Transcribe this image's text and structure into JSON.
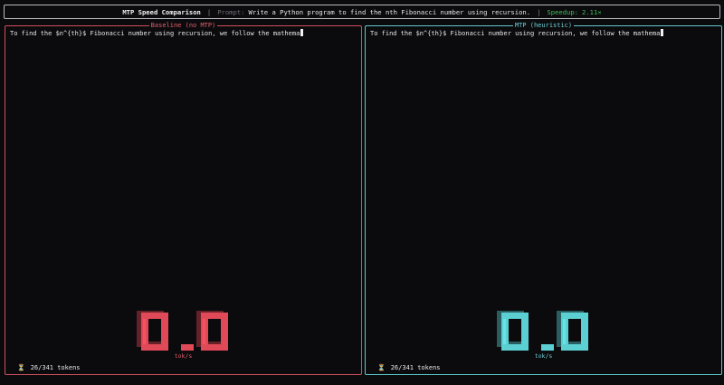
{
  "header": {
    "title": "MTP Speed Comparison",
    "separator": "|",
    "prompt_label": "Prompt:",
    "prompt": "Write a Python program to find the nth Fibonacci number using recursion.",
    "speedup_label": "Speedup:",
    "speedup": "2.11×"
  },
  "colors": {
    "baseline": "#e04a58",
    "mtp": "#5ccfd2",
    "speedup": "#3fbf5a"
  },
  "baseline": {
    "title": "Baseline (no MTP)",
    "text": "To find the $n^{th}$ Fibonacci number using recursion, we follow the mathema",
    "rate": "0.0",
    "rate_unit": "tok/s",
    "tokens_icon": "hourglass-icon",
    "tokens": "26/341 tokens"
  },
  "mtp": {
    "title": "MTP (heuristic)",
    "text": "To find the $n^{th}$ Fibonacci number using recursion, we follow the mathema",
    "rate": "0.0",
    "rate_unit": "tok/s",
    "tokens_icon": "hourglass-icon",
    "tokens": "26/341 tokens"
  }
}
